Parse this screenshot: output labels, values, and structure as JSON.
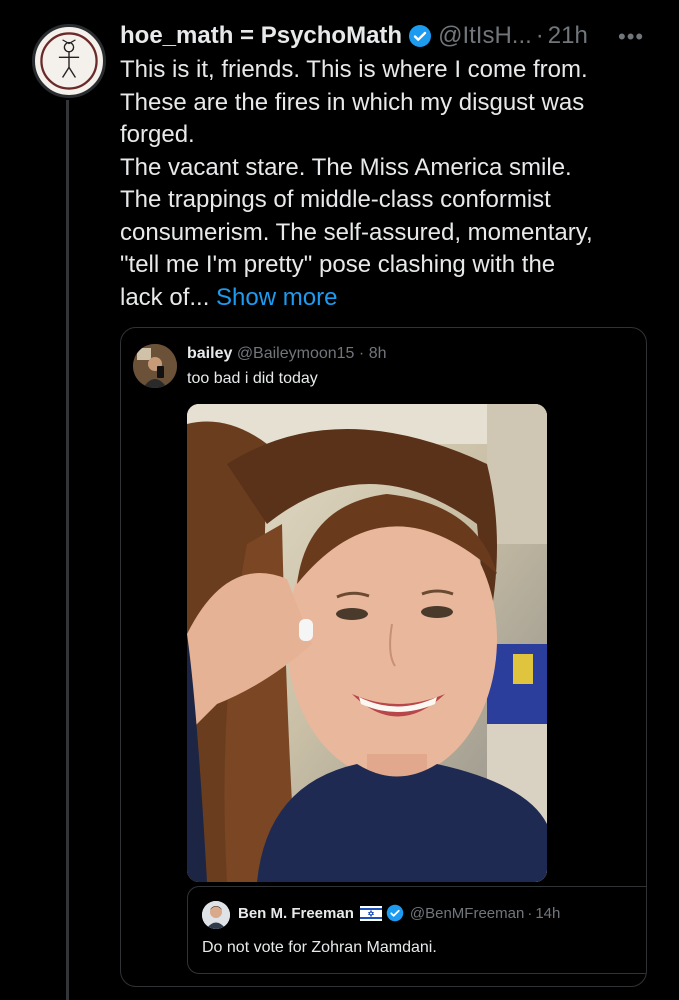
{
  "tweet": {
    "display_name": "hoe_math = PsychoMath",
    "handle": "@ItIsH...",
    "separator": "·",
    "time": "21h",
    "more_icon": "more-horizontal-icon",
    "text": "This is it, friends. This is where I come from.\nThese are the fires in which my disgust was\nforged.\nThe vacant stare. The Miss America smile.\nThe trappings of middle-class conformist\nconsumerism. The self-assured, momentary,\n\"tell me I'm pretty\" pose clashing with the\nlack of... ",
    "show_more": "Show more",
    "verified_icon": "verified-badge-icon"
  },
  "quote": {
    "display_name": "bailey",
    "handle": "@Baileymoon15",
    "separator": "·",
    "time": "8h",
    "text": "too bad i did today",
    "image": "selfie-photo"
  },
  "nested_quote": {
    "display_name": "Ben M. Freeman",
    "flag_icon": "israel-flag-icon",
    "verified_icon": "verified-badge-icon",
    "handle": "@BenMFreeman",
    "separator": "·",
    "time": "14h",
    "text": "Do not vote for Zohran Mamdani."
  },
  "colors": {
    "background": "#000000",
    "text": "#e7e9ea",
    "muted": "#71767b",
    "accent": "#1d9bf0",
    "border": "#2f3336"
  }
}
